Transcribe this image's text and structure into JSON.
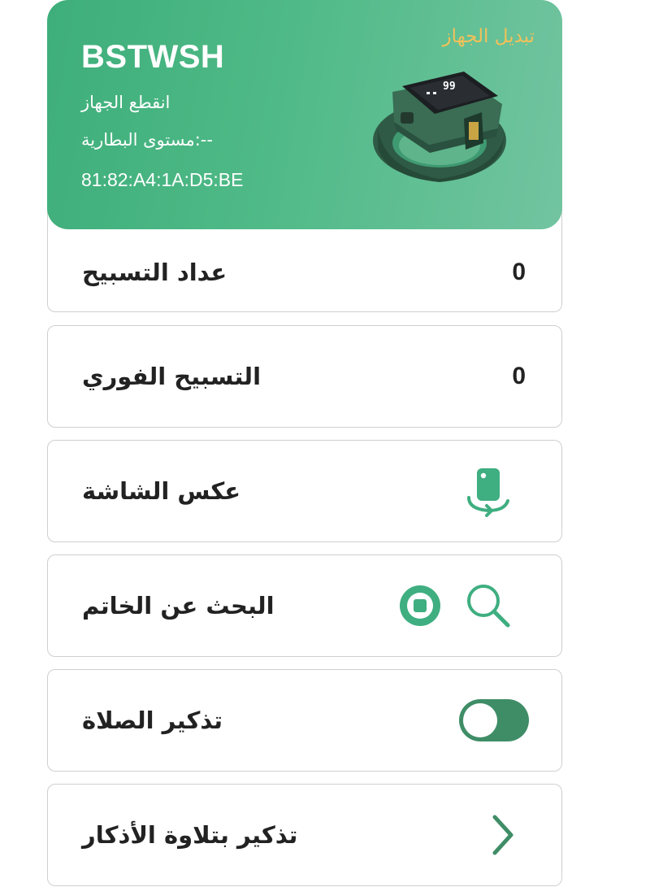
{
  "device": {
    "name": "BSTWSH",
    "status": "انقطع الجهاز",
    "battery": "مستوى البطارية:--",
    "mac": "81:82:A4:1A:D5:BE",
    "switch_label": "تبديل الجهاز",
    "ring_display": "99"
  },
  "colors": {
    "accent": "#3eae7a",
    "toggle": "#3f8d67",
    "switch_link": "#f1c15a"
  },
  "rows": {
    "tasbih_counter": {
      "label": "عداد التسبيح",
      "value": "0"
    },
    "instant_tasbih": {
      "label": "التسبيح الفوري",
      "value": "0"
    },
    "flip_screen": {
      "label": "عكس الشاشة",
      "icon": "rotate-device-icon"
    },
    "find_ring": {
      "label": "البحث عن الخاتم",
      "icons": [
        "search-icon",
        "stop-icon"
      ]
    },
    "prayer_reminder": {
      "label": "تذكير الصلاة",
      "toggle_on": false
    },
    "dhikr_reminder": {
      "label": "تذكير بتلاوة الأذكار",
      "icon": "chevron-right-icon"
    }
  }
}
